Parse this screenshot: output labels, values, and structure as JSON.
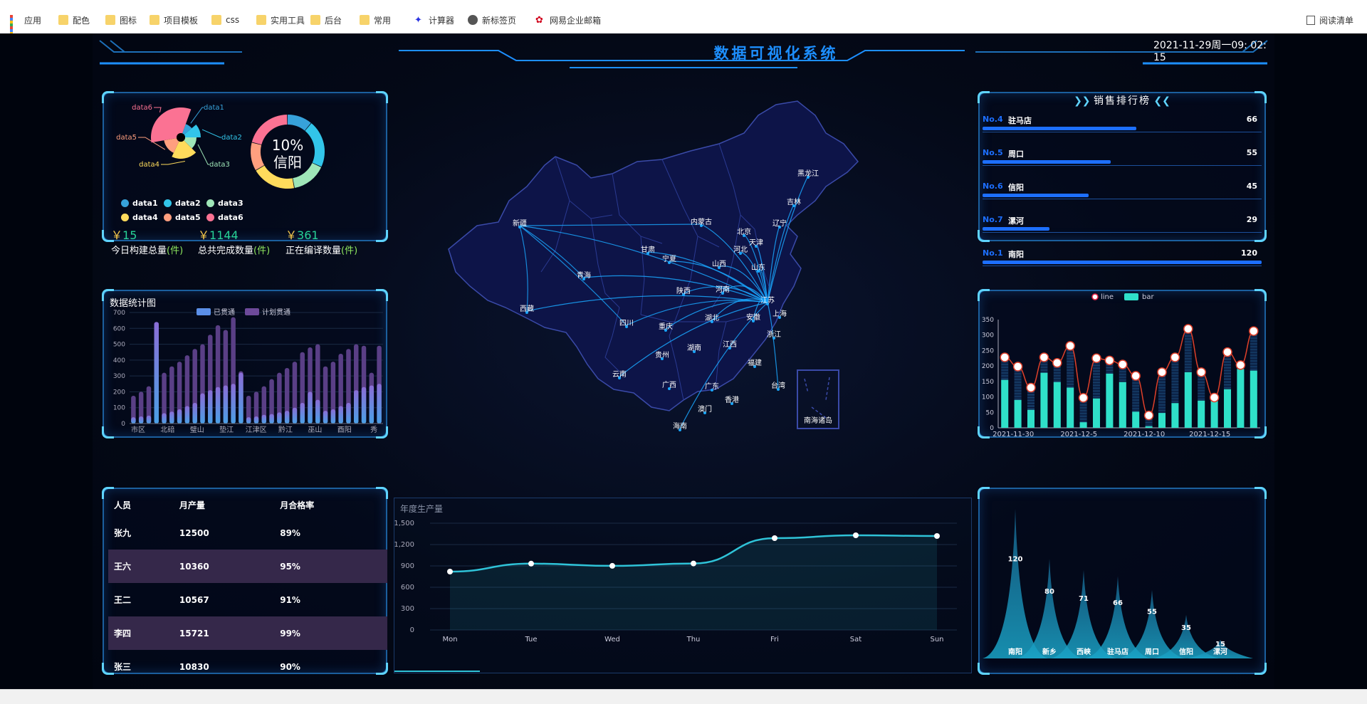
{
  "bookmarks": {
    "items": [
      {
        "label": "应用",
        "icon": "apps-grid-icon"
      },
      {
        "label": "配色",
        "icon": "folder-icon"
      },
      {
        "label": "图标",
        "icon": "folder-icon"
      },
      {
        "label": "项目模板",
        "icon": "folder-icon"
      },
      {
        "label": "css",
        "icon": "folder-icon"
      },
      {
        "label": "实用工具",
        "icon": "folder-icon"
      },
      {
        "label": "后台",
        "icon": "folder-icon"
      },
      {
        "label": "常用",
        "icon": "folder-icon"
      },
      {
        "label": "计算器",
        "icon": "baidu-paw-icon"
      },
      {
        "label": "新标签页",
        "icon": "globe-icon"
      },
      {
        "label": "网易企业邮箱",
        "icon": "netease-icon"
      }
    ],
    "reading_list": "阅读清单"
  },
  "header": {
    "title": "数据可视化系统",
    "datetime": "2021-11-29周一09: 02: 15"
  },
  "pie_panel": {
    "rose": {
      "labels": [
        "data1",
        "data2",
        "data3",
        "data4",
        "data5",
        "data6"
      ],
      "colors": [
        "#37a2da",
        "#32c5e9",
        "#9fe6b8",
        "#ffdb5c",
        "#ff9f7f",
        "#fb7293"
      ]
    },
    "donut": {
      "percent": "10%",
      "city": "信阳"
    },
    "legend": [
      {
        "label": "data1",
        "color": "#37a2da"
      },
      {
        "label": "data2",
        "color": "#32c5e9"
      },
      {
        "label": "data3",
        "color": "#9fe6b8"
      },
      {
        "label": "data4",
        "color": "#ffdb5c"
      },
      {
        "label": "data5",
        "color": "#ff9f7f"
      },
      {
        "label": "data6",
        "color": "#fb7293"
      }
    ],
    "stats": [
      {
        "currency": "￥",
        "value": "15",
        "label": "今日构建总量",
        "unit": "(件)"
      },
      {
        "currency": "￥",
        "value": "1144",
        "label": "总共完成数量",
        "unit": "(件)"
      },
      {
        "currency": "￥",
        "value": "361",
        "label": "正在编译数量",
        "unit": "(件)"
      }
    ]
  },
  "chart_data": [
    {
      "type": "bar",
      "title": "数据统计图",
      "legend": [
        "已贯通",
        "计划贯通"
      ],
      "ylim": [
        0,
        700
      ],
      "yticks": [
        0,
        100,
        200,
        300,
        400,
        500,
        600,
        700
      ],
      "xtick_labels": [
        "市区",
        "北碚",
        "璧山",
        "垫江",
        "江津区",
        "黔江",
        "巫山",
        "酉阳",
        "秀"
      ],
      "series": [
        {
          "name": "已贯通",
          "values": [
            40,
            45,
            50,
            640,
            65,
            75,
            90,
            110,
            130,
            190,
            210,
            230,
            240,
            250,
            320,
            40,
            45,
            55,
            60,
            70,
            80,
            100,
            130,
            200,
            150,
            80,
            90,
            110,
            130,
            210,
            230,
            240,
            250
          ]
        },
        {
          "name": "计划贯通",
          "values": [
            175,
            200,
            235,
            640,
            320,
            360,
            390,
            430,
            470,
            500,
            560,
            620,
            590,
            670,
            330,
            175,
            200,
            235,
            280,
            320,
            350,
            390,
            450,
            480,
            500,
            360,
            390,
            440,
            470,
            500,
            490,
            320,
            490
          ]
        }
      ]
    },
    {
      "type": "bar",
      "legend": [
        "line",
        "bar"
      ],
      "ylim": [
        0,
        350
      ],
      "yticks": [
        0,
        50,
        100,
        150,
        200,
        250,
        300,
        350
      ],
      "xtick_labels": [
        "2021-11-30",
        "2021-12-5",
        "2021-12-10",
        "2021-12-15"
      ],
      "series": [
        {
          "name": "line",
          "values": [
            228,
            198,
            130,
            228,
            210,
            265,
            97,
            225,
            218,
            205,
            168,
            40,
            180,
            228,
            320,
            180,
            98,
            245,
            203,
            313
          ]
        },
        {
          "name": "bar",
          "values": [
            155,
            90,
            58,
            178,
            148,
            130,
            18,
            95,
            175,
            148,
            52,
            5,
            48,
            80,
            180,
            88,
            92,
            125,
            190,
            185
          ]
        },
        {
          "name": "bg",
          "values": [
            228,
            198,
            130,
            228,
            210,
            265,
            97,
            225,
            218,
            205,
            168,
            40,
            180,
            228,
            320,
            180,
            98,
            245,
            203,
            313
          ]
        }
      ]
    },
    {
      "type": "line",
      "title": "年度生产量",
      "categories": [
        "Mon",
        "Tue",
        "Wed",
        "Thu",
        "Fri",
        "Sat",
        "Sun"
      ],
      "values": [
        820,
        932,
        901,
        934,
        1290,
        1330,
        1320
      ],
      "ylim": [
        0,
        1500
      ],
      "yticks": [
        "0",
        "300",
        "600",
        "900",
        "1,200",
        "1,500"
      ]
    },
    {
      "type": "bar",
      "categories": [
        "南阳",
        "新乡",
        "西峡",
        "驻马店",
        "周口",
        "信阳",
        "漯河"
      ],
      "values": [
        120,
        80,
        71,
        66,
        55,
        35,
        15
      ]
    }
  ],
  "ranking": {
    "title": "销售排行榜",
    "items": [
      {
        "no": "No.4",
        "name": "驻马店",
        "value": "66",
        "fraction": 0.55
      },
      {
        "no": "No.5",
        "name": "周口",
        "value": "55",
        "fraction": 0.46
      },
      {
        "no": "No.6",
        "name": "信阳",
        "value": "45",
        "fraction": 0.38
      },
      {
        "no": "No.7",
        "name": "漯河",
        "value": "29",
        "fraction": 0.24
      },
      {
        "no": "No.1",
        "name": "南阳",
        "value": "120",
        "fraction": 1.0
      }
    ]
  },
  "people_table": {
    "headers": [
      "人员",
      "月产量",
      "月合格率"
    ],
    "rows": [
      [
        "张九",
        "12500",
        "89%"
      ],
      [
        "王六",
        "10360",
        "95%"
      ],
      [
        "王二",
        "10567",
        "91%"
      ],
      [
        "李四",
        "15721",
        "99%"
      ],
      [
        "张三",
        "10830",
        "90%"
      ]
    ]
  },
  "map": {
    "provinces": [
      "黑龙江",
      "吉林",
      "辽宁",
      "内蒙古",
      "北京",
      "天津",
      "河北",
      "山西",
      "山东",
      "宁夏",
      "甘肃",
      "新疆",
      "青海",
      "西藏",
      "陕西",
      "河南",
      "江苏",
      "上海",
      "安徽",
      "湖北",
      "浙江",
      "四川",
      "重庆",
      "贵州",
      "湖南",
      "江西",
      "福建",
      "云南",
      "广西",
      "广东",
      "台湾",
      "香港",
      "澳门",
      "海南"
    ],
    "inset_label": "南海诸岛",
    "hub_color": "#1aa7ff"
  }
}
